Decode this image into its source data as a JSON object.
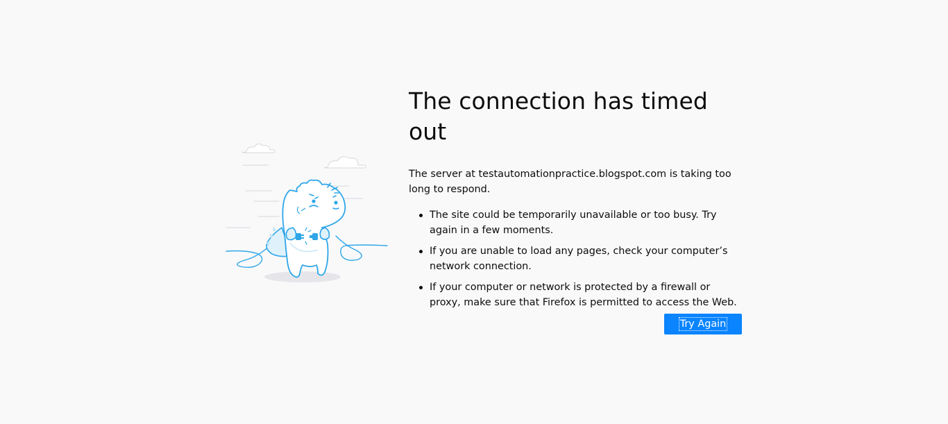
{
  "error": {
    "title": "The connection has timed out",
    "description": "The server at testautomationpractice.blogspot.com is taking too long to respond.",
    "tips": [
      "The site could be temporarily unavailable or too busy. Try again in a few moments.",
      "If you are unable to load any pages, check your computer’s network connection.",
      "If your computer or network is protected by a firewall or proxy, make sure that Firefox is permitted to access the Web."
    ],
    "try_again_label": "Try Again"
  },
  "illustration": {
    "name": "unplugged-dinosaur-illustration",
    "colors": {
      "stroke": "#2ea6e8",
      "fill_light": "#dff2fc",
      "shadow": "#e6e6ea",
      "cloud": "#ededf0"
    }
  },
  "theme": {
    "background": "#f9f9fa",
    "button": "#0a84ff",
    "text": "#0c0c0d"
  }
}
